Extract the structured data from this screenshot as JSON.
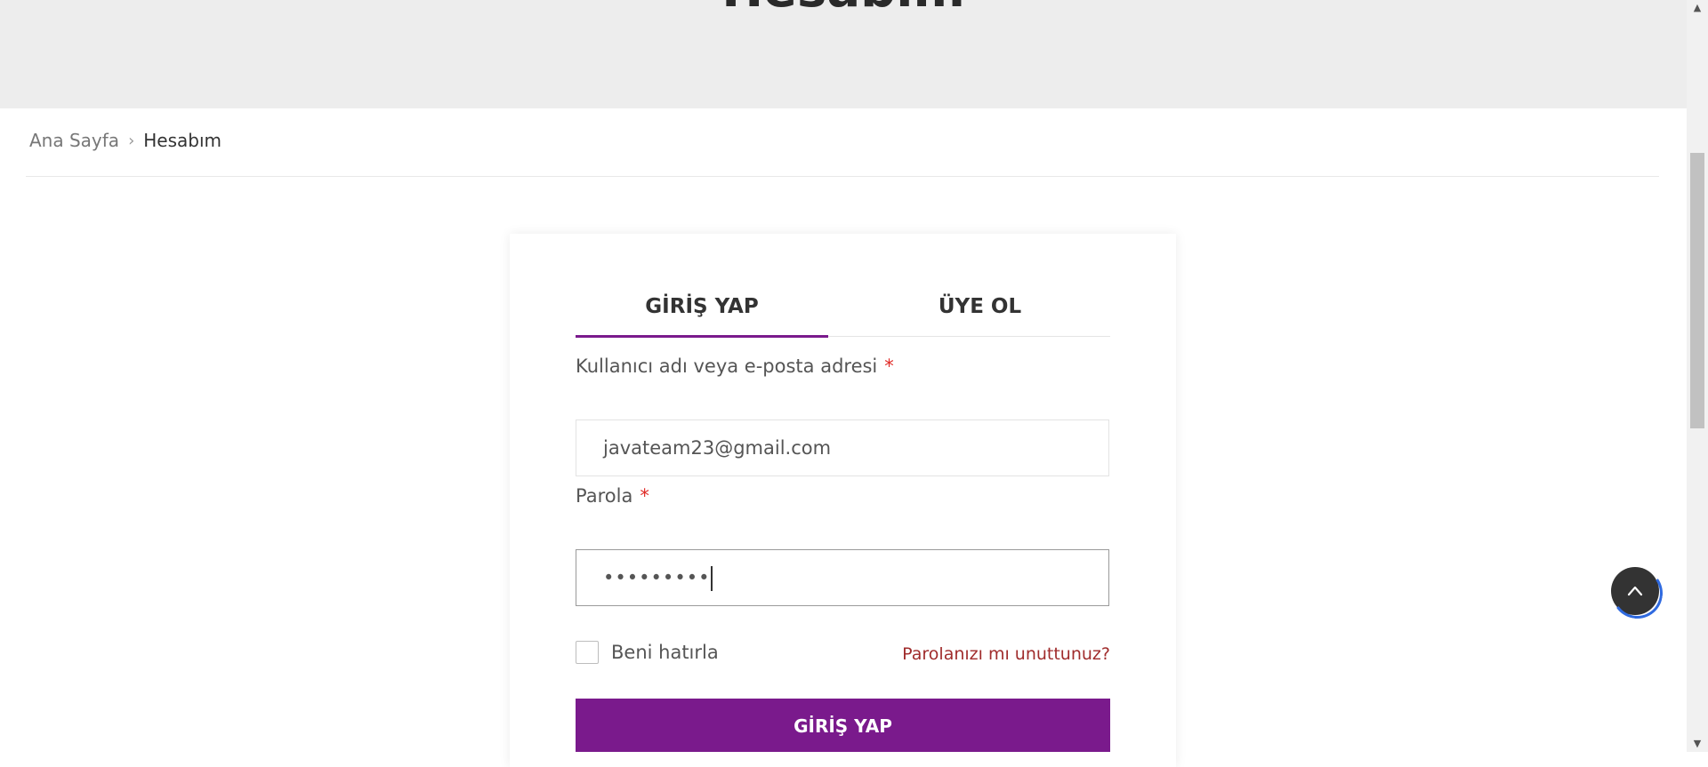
{
  "hero": {
    "title": "Hesabım"
  },
  "breadcrumb": {
    "home": "Ana Sayfa",
    "separator": "›",
    "current": "Hesabım"
  },
  "tabs": {
    "login": "GİRİŞ YAP",
    "register": "ÜYE OL",
    "active": "login"
  },
  "form": {
    "username_label": "Kullanıcı adı veya e-posta adresi",
    "username_value": "javateam23@gmail.com",
    "password_label": "Parola",
    "password_value": "•••••••••",
    "required_mark": "*",
    "remember_label": "Beni hatırla",
    "remember_checked": false,
    "forgot_link": "Parolanızı mı unuttunuz?",
    "submit_label": "GİRİŞ YAP"
  },
  "colors": {
    "accent": "#7a1a8c",
    "hero_bg": "#ededed",
    "link": "#a02c2c",
    "required": "#e02b27"
  },
  "icons": {
    "scroll_top": "chevron-up-icon",
    "breadcrumb_separator": "chevron-right-icon"
  }
}
